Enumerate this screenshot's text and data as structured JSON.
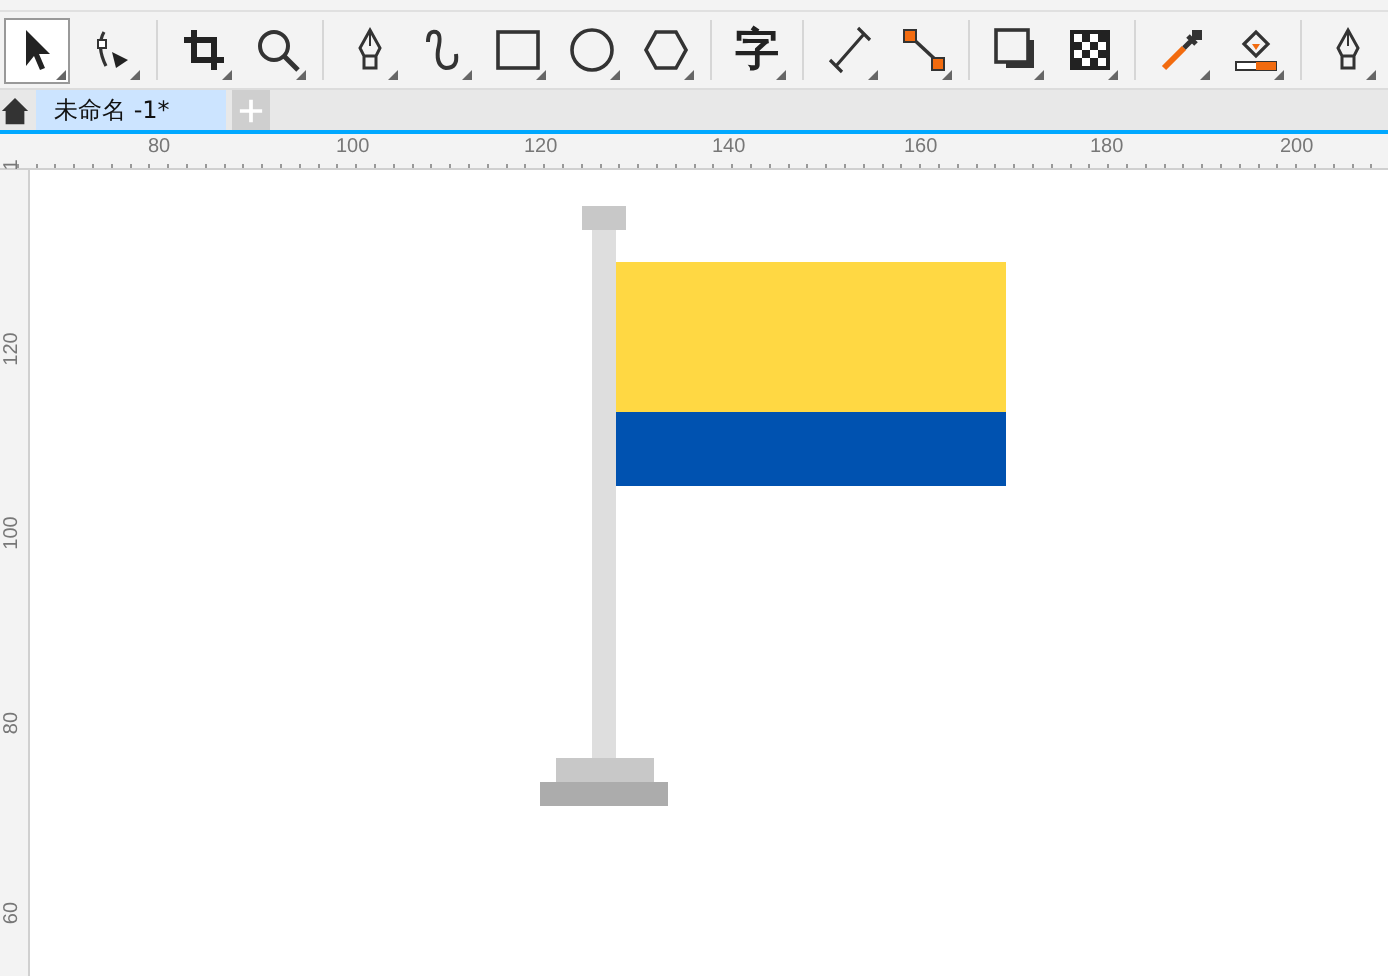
{
  "toolbar": {
    "groups": [
      [
        {
          "kind": "select",
          "selected": true
        },
        {
          "kind": "shape",
          "selected": false
        }
      ],
      [
        {
          "kind": "crop",
          "selected": false
        },
        {
          "kind": "zoom",
          "selected": false
        }
      ],
      [
        {
          "kind": "pen",
          "selected": false
        },
        {
          "kind": "freehand",
          "selected": false
        },
        {
          "kind": "rectangle",
          "selected": false
        },
        {
          "kind": "ellipse",
          "selected": false
        },
        {
          "kind": "polygon",
          "selected": false
        }
      ],
      [
        {
          "kind": "text",
          "label": "字",
          "selected": false
        }
      ],
      [
        {
          "kind": "dimension",
          "selected": false
        },
        {
          "kind": "connector",
          "selected": false
        }
      ],
      [
        {
          "kind": "shadow",
          "selected": false
        },
        {
          "kind": "transparency",
          "selected": false
        }
      ],
      [
        {
          "kind": "eyedropper",
          "selected": false
        },
        {
          "kind": "fill",
          "selected": false
        }
      ],
      [
        {
          "kind": "outline",
          "selected": false
        }
      ]
    ]
  },
  "tabs": [
    {
      "label": "未命名 -1*",
      "selected": true
    }
  ],
  "rulers": {
    "horizontal": [
      "80",
      "100",
      "120",
      "140",
      "160",
      "180",
      "200"
    ],
    "vertical": [
      "1",
      "120",
      "100",
      "80",
      "60"
    ]
  },
  "canvas": {
    "flag": {
      "stripes": [
        {
          "color": "#ffd843"
        },
        {
          "color": "#0052b0"
        }
      ]
    }
  }
}
